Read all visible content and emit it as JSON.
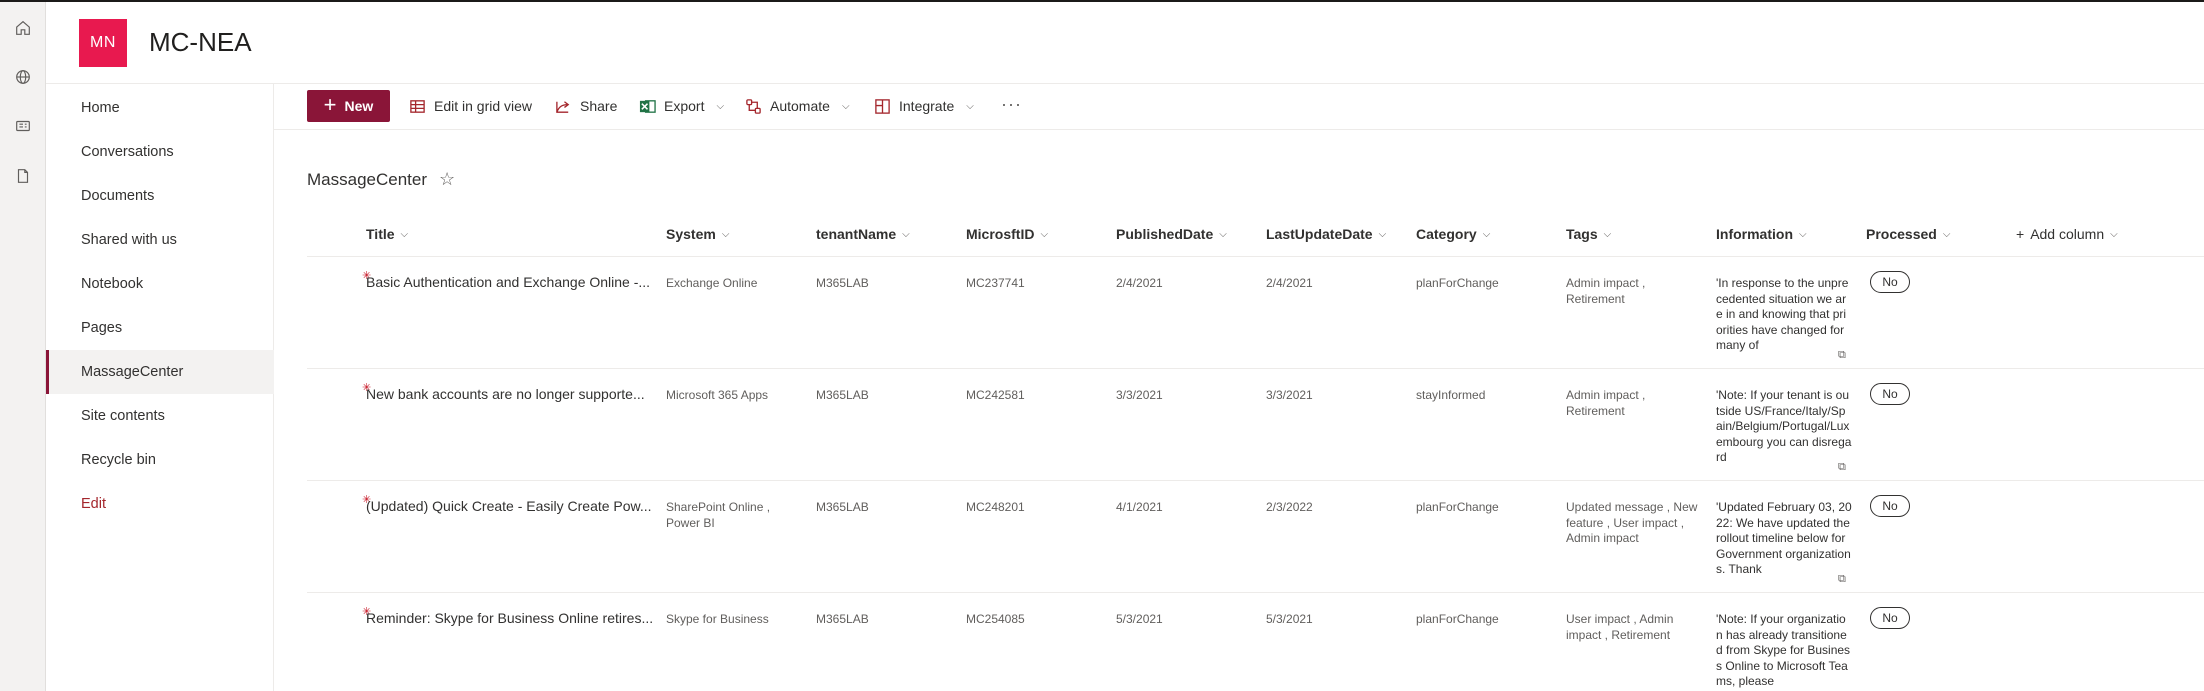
{
  "site": {
    "logo_initials": "MN",
    "title": "MC-NEA"
  },
  "appbar": {
    "icons": [
      "home-icon",
      "globe-icon",
      "news-icon",
      "document-icon"
    ]
  },
  "nav": {
    "items": [
      {
        "label": "Home"
      },
      {
        "label": "Conversations"
      },
      {
        "label": "Documents"
      },
      {
        "label": "Shared with us"
      },
      {
        "label": "Notebook"
      },
      {
        "label": "Pages"
      },
      {
        "label": "MassageCenter",
        "selected": true
      },
      {
        "label": "Site contents"
      },
      {
        "label": "Recycle bin"
      },
      {
        "label": "Edit"
      }
    ]
  },
  "commandbar": {
    "new_label": "New",
    "edit_grid_label": "Edit in grid view",
    "share_label": "Share",
    "export_label": "Export",
    "automate_label": "Automate",
    "integrate_label": "Integrate",
    "more_label": "···"
  },
  "list": {
    "title": "MassageCenter",
    "favorite_glyph": "☆",
    "columns": [
      "Title",
      "System",
      "tenantName",
      "MicrosftID",
      "PublishedDate",
      "LastUpdateDate",
      "Category",
      "Tags",
      "Information",
      "Processed",
      "Add column"
    ],
    "rows": [
      {
        "title": "Basic Authentication and Exchange Online -...",
        "system": "Exchange Online",
        "tenant": "M365LAB",
        "id": "MC237741",
        "published": "2/4/2021",
        "updated": "2/4/2021",
        "category": "planForChange",
        "tags": "Admin impact , Retirement",
        "information": "'In response to the unprecedented situation we are in and knowing that priorities have changed for many of",
        "processed": "No"
      },
      {
        "title": "New bank accounts are no longer supporte...",
        "system": "Microsoft 365 Apps",
        "tenant": "M365LAB",
        "id": "MC242581",
        "published": "3/3/2021",
        "updated": "3/3/2021",
        "category": "stayInformed",
        "tags": "Admin impact , Retirement",
        "information": "'Note: If your tenant is outside US/France/Italy/Spain/Belgium/Portugal/Luxembourg you can disregard",
        "processed": "No"
      },
      {
        "title": "(Updated) Quick Create - Easily Create Pow...",
        "system": "SharePoint Online , Power BI",
        "tenant": "M365LAB",
        "id": "MC248201",
        "published": "4/1/2021",
        "updated": "2/3/2022",
        "category": "planForChange",
        "tags": "Updated message , New feature , User impact , Admin impact",
        "information": "'Updated February 03, 2022: We have updated the rollout timeline below for Government organizations. Thank",
        "processed": "No"
      },
      {
        "title": "Reminder: Skype for Business Online retires...",
        "system": "Skype for Business",
        "tenant": "M365LAB",
        "id": "MC254085",
        "published": "5/3/2021",
        "updated": "5/3/2021",
        "category": "planForChange",
        "tags": "User impact , Admin impact , Retirement",
        "information": "'Note: If your organization has already transitioned from Skype for Business Online to Microsoft Teams, please",
        "processed": "No"
      }
    ]
  },
  "colors": {
    "brand": "#8a1538",
    "logo_bg": "#e8194f"
  }
}
